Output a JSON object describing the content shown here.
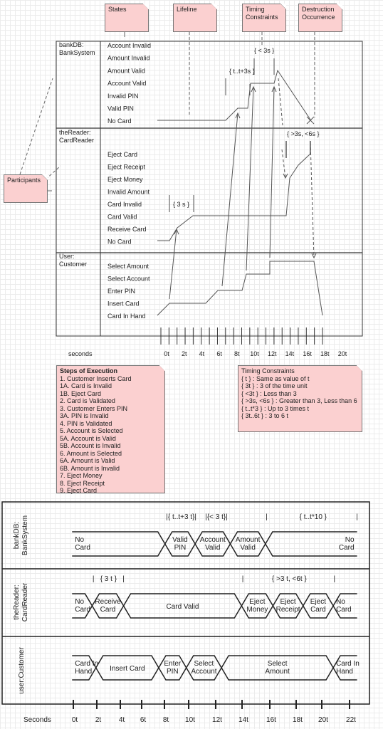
{
  "notes": {
    "states": "States",
    "lifeline": "Lifeline",
    "timing_constraints_1": "Timing",
    "timing_constraints_2": "Constraints",
    "destruction_1": "Destruction",
    "destruction_2": "Occurrence",
    "participants": "Participants"
  },
  "top_diagram": {
    "lifelines": [
      {
        "name1": "bankDB:",
        "name2": "BankSystem",
        "states": [
          "Account Invalid",
          "Amount Invalid",
          "Amount Valid",
          "Account Valid",
          "Invalid PIN",
          "Valid PIN",
          "No Card"
        ]
      },
      {
        "name1": "theReader:",
        "name2": "CardReader",
        "states": [
          "Eject Card",
          "Eject Receipt",
          "Eject Money",
          "Invalid Amount",
          "Card Invalid",
          "Card Valid",
          "Receive Card",
          "No Card"
        ]
      },
      {
        "name1": "User:",
        "name2": "Customer",
        "states": [
          "Select Amount",
          "Select Account",
          "Enter PIN",
          "Insert Card",
          "Card In Hand"
        ]
      }
    ],
    "constraints": {
      "c1": "{ < 3s }",
      "c2": "{ t..t+3s }",
      "c3": "{ >3s, <6s }",
      "c4": "{ 3 s }"
    },
    "axis_label": "seconds",
    "ticks": [
      "0t",
      "2t",
      "4t",
      "6t",
      "8t",
      "10t",
      "12t",
      "14t",
      "16t",
      "18t",
      "20t"
    ]
  },
  "steps_note": {
    "title": "Steps of Execution",
    "items": [
      "1. Customer Inserts Card",
      "1A. Card is Invalid",
      "1B. Eject Card",
      "2. Card is Validated",
      "3. Customer Enters PIN",
      "3A. PIN is Invalid",
      "4. PIN is Validated",
      "5. Account is Selected",
      "5A. Account is Valid",
      "5B. Account is Invalid",
      "6. Amount is Selected",
      "6A. Amount is Valid",
      "6B. Amount is Invalid",
      "7. Eject Money",
      "8. Eject Receipt",
      "9. Eject Card"
    ]
  },
  "timing_note": {
    "title": "Timing Constraints",
    "items": [
      "{ t } : Same as value of t",
      "{ 3t } : 3 of the time unit",
      "{ <3t } : Less than 3",
      "{ >3s, <6s } : Greater than 3, Less than 6",
      "{ t..t*3 } : Up to 3 times t",
      "{ 3t..6t } : 3 to 6 t"
    ]
  },
  "bottom_diagram": {
    "axis_label": "Seconds",
    "ticks": [
      "0t",
      "2t",
      "4t",
      "6t",
      "8t",
      "10t",
      "12t",
      "14t",
      "16t",
      "18t",
      "20t",
      "22t"
    ],
    "rows": [
      {
        "name1": "bankDB:",
        "name2": "BankSystem",
        "states": [
          {
            "l1": "No",
            "l2": "Card",
            "start": -0.1,
            "end": 7.3,
            "align": "left"
          },
          {
            "l1": "Valid",
            "l2": "PIN",
            "start": 7.3,
            "end": 9.7
          },
          {
            "l1": "Account",
            "l2": "Valid",
            "start": 9.7,
            "end": 12.5
          },
          {
            "l1": "Amount",
            "l2": "Valid",
            "start": 12.5,
            "end": 15.3
          },
          {
            "l1": "No",
            "l2": "Card",
            "start": 15.3,
            "end": 22.6,
            "align": "right"
          }
        ],
        "constraints": [
          {
            "text": "|{ t..t+3 t}|",
            "at": 8.6
          },
          {
            "text": "|{< 3 t}|",
            "at": 11.4
          },
          {
            "text": "|",
            "at": 15.4
          },
          {
            "text": "{ t..t*10 }",
            "at": 19.1
          },
          {
            "text": "|",
            "at": 22.6
          }
        ]
      },
      {
        "name1": "theReader:",
        "name2": "CardReader",
        "states": [
          {
            "l1": "No",
            "l2": "Card",
            "start": -0.1,
            "end": 1.5,
            "align": "left"
          },
          {
            "l1": "Receive",
            "l2": "Card",
            "start": 1.5,
            "end": 4.0
          },
          {
            "l1": "Card Valid",
            "l2": "",
            "start": 4.0,
            "end": 13.4
          },
          {
            "l1": "Eject",
            "l2": "Money",
            "start": 13.4,
            "end": 15.9
          },
          {
            "l1": "Eject",
            "l2": "Receipt",
            "start": 15.9,
            "end": 18.3
          },
          {
            "l1": "Eject",
            "l2": "Card",
            "start": 18.3,
            "end": 20.7
          },
          {
            "l1": "No",
            "l2": "Card",
            "start": 20.7,
            "end": 22.6,
            "align": "left"
          }
        ],
        "constraints": [
          {
            "text": "|",
            "at": 1.6
          },
          {
            "text": "{ 3 t }",
            "at": 2.8
          },
          {
            "text": "|",
            "at": 4.0
          },
          {
            "text": "|",
            "at": 13.5
          },
          {
            "text": "{ >3 t, <6t }",
            "at": 17.2
          },
          {
            "text": "|",
            "at": 20.8
          }
        ]
      },
      {
        "name1": "user:Customer",
        "name2": "",
        "states": [
          {
            "l1": "Card In",
            "l2": "Hand",
            "start": -0.1,
            "end": 1.8,
            "align": "left"
          },
          {
            "l1": "Insert Card",
            "l2": "",
            "start": 1.8,
            "end": 6.8
          },
          {
            "l1": "Enter",
            "l2": "PIN",
            "start": 6.8,
            "end": 9.0
          },
          {
            "l1": "Select",
            "l2": "Account",
            "start": 9.0,
            "end": 11.8
          },
          {
            "l1": "Select",
            "l2": "Amount",
            "start": 11.8,
            "end": 20.7
          },
          {
            "l1": "Card In",
            "l2": "Hand",
            "start": 20.7,
            "end": 22.6,
            "align": "left"
          }
        ],
        "constraints": []
      }
    ]
  }
}
